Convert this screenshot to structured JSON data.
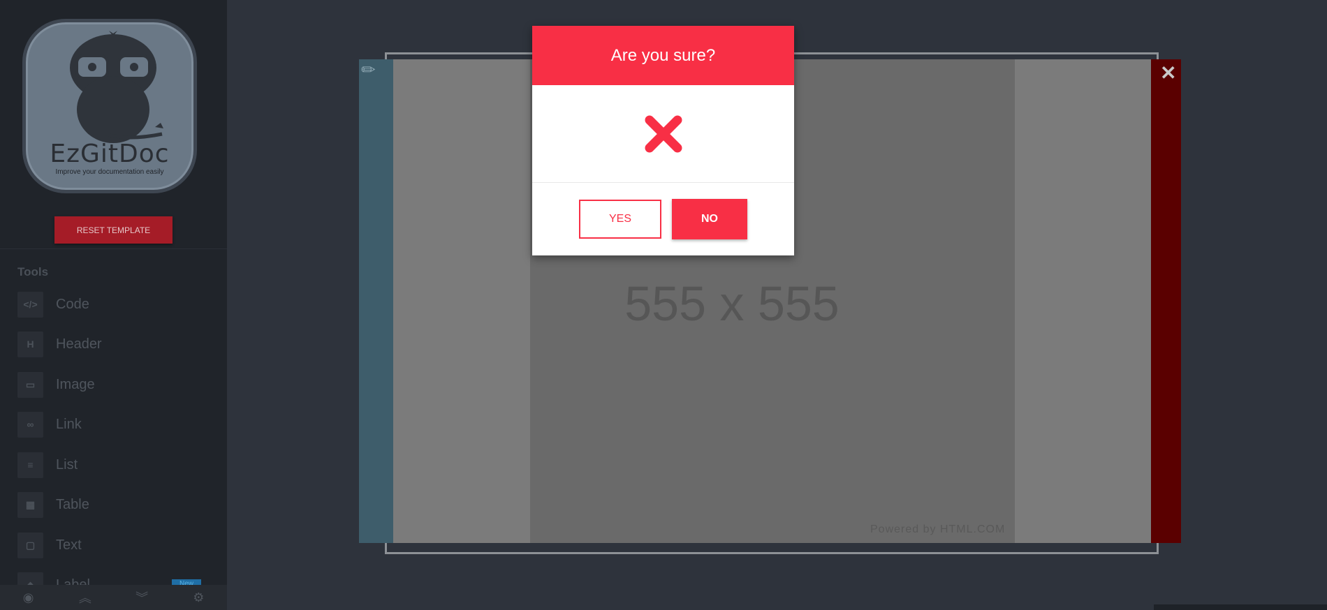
{
  "logo": {
    "title": "EzGitDoc",
    "subtitle": "Improve your documentation easily"
  },
  "sidebar": {
    "reset_label": "RESET TEMPLATE",
    "tools_title": "Tools",
    "items": [
      {
        "label": "Code",
        "icon": "code-icon",
        "glyph": "</>"
      },
      {
        "label": "Header",
        "icon": "header-icon",
        "glyph": "H"
      },
      {
        "label": "Image",
        "icon": "image-icon",
        "glyph": "▭"
      },
      {
        "label": "Link",
        "icon": "link-icon",
        "glyph": "∞"
      },
      {
        "label": "List",
        "icon": "list-icon",
        "glyph": "≡"
      },
      {
        "label": "Table",
        "icon": "table-icon",
        "glyph": "▦"
      },
      {
        "label": "Text",
        "icon": "text-icon",
        "glyph": "▢"
      },
      {
        "label": "Label",
        "icon": "tag-icon",
        "glyph": "◆"
      }
    ],
    "new_badge": "New"
  },
  "bottom_bar": {
    "icons": [
      {
        "name": "eye-icon",
        "glyph": "◉"
      },
      {
        "name": "double-chevron-up-icon",
        "glyph": "︽"
      },
      {
        "name": "double-chevron-down-icon",
        "glyph": "︾"
      },
      {
        "name": "gear-icon",
        "glyph": "⚙"
      }
    ]
  },
  "canvas": {
    "placeholder_text": "555 x 555",
    "powered_text": "Powered by HTML.COM",
    "edit_icon": "pencil-icon",
    "delete_icon": "close-icon"
  },
  "modal": {
    "title": "Are you sure?",
    "icon": "x-mark-icon",
    "yes_label": "YES",
    "no_label": "NO",
    "accent_color": "#f82f45"
  }
}
